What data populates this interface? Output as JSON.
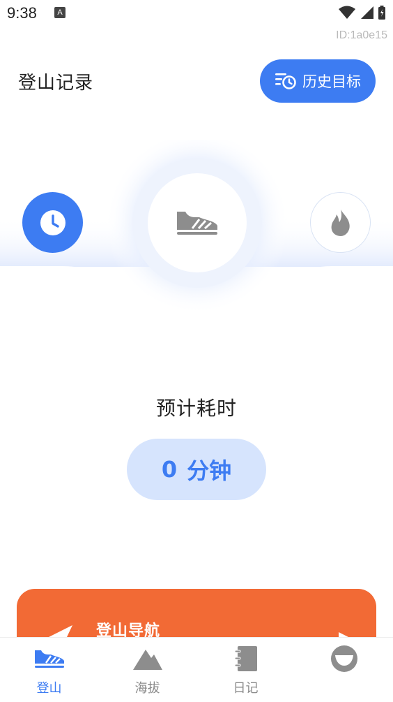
{
  "status_bar": {
    "time": "9:38",
    "app_indicator": "A"
  },
  "device_id": "ID:1a0e15",
  "header": {
    "title": "登山记录",
    "history_button_label": "历史目标"
  },
  "modes": {
    "left": "clock-icon",
    "center": "shoe-icon",
    "right": "flame-icon"
  },
  "estimate": {
    "label": "预计耗时",
    "value": "0",
    "unit": "分钟"
  },
  "nav_card": {
    "title": "登山导航"
  },
  "tabs": [
    {
      "label": "登山",
      "icon": "shoe-icon",
      "active": true
    },
    {
      "label": "海拔",
      "icon": "mountain-icon",
      "active": false
    },
    {
      "label": "日记",
      "icon": "notebook-icon",
      "active": false
    },
    {
      "label": "",
      "icon": "profile-icon",
      "active": false
    }
  ],
  "colors": {
    "primary": "#3d7cf2",
    "accent": "#f26a35",
    "pill_bg": "#d6e4fd"
  }
}
